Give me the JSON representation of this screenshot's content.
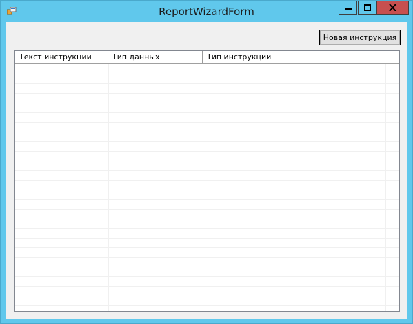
{
  "window": {
    "title": "ReportWizardForm",
    "controls": {
      "minimize": "minimize",
      "maximize": "maximize",
      "close": "close"
    }
  },
  "toolbar": {
    "new_instruction_label": "Новая инструкция"
  },
  "list": {
    "columns": [
      {
        "label": "Текст инструкции"
      },
      {
        "label": "Тип данных"
      },
      {
        "label": "Тип инструкции"
      }
    ],
    "rows": []
  },
  "colors": {
    "frame": "#60c8ec",
    "close_button": "#c74f4f",
    "client_bg": "#f0f0f0"
  }
}
